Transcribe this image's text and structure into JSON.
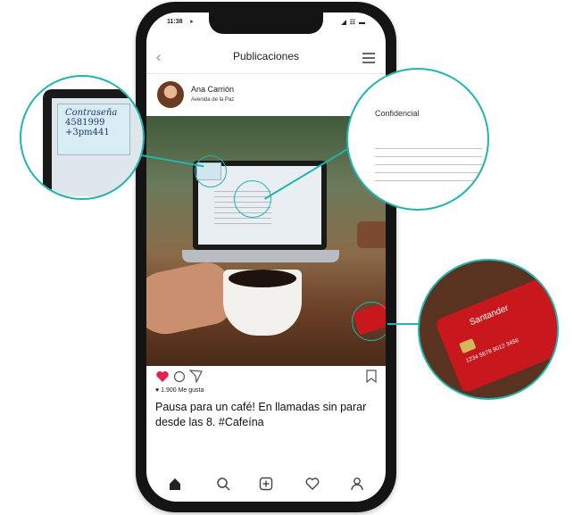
{
  "status_bar": {
    "time": "11:38",
    "icons": "◢ ☷ ▬"
  },
  "header": {
    "title": "Publicaciones",
    "back_label": "‹"
  },
  "post": {
    "user_name": "Ana Carrión",
    "location": "Avenida de la Paz",
    "likes": "1.900 Me gusta",
    "caption": "Pausa para un café! En llamadas sin parar desde las 8. #Cafeína"
  },
  "zoom_note": {
    "title": "Contraseña",
    "line1": "4581999",
    "line2": "+3pm441"
  },
  "zoom_doc": {
    "heading": "Confidencial"
  },
  "zoom_card": {
    "brand": "Santander",
    "number": "1234 5678 9012 3456"
  },
  "colors": {
    "accent": "#20b5b0",
    "like": "#e8204f",
    "card": "#c8181d"
  }
}
